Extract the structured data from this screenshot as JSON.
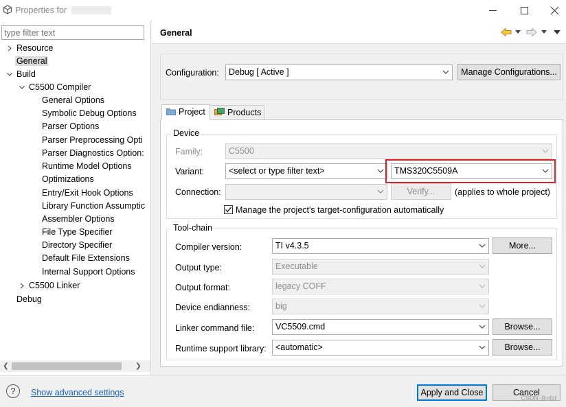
{
  "window": {
    "title": "Properties for"
  },
  "sidebar": {
    "filter_placeholder": "type filter text",
    "items": [
      {
        "label": "Resource"
      },
      {
        "label": "General"
      },
      {
        "label": "Build"
      },
      {
        "label": "C5500 Compiler"
      },
      {
        "label": "General Options"
      },
      {
        "label": "Symbolic Debug Options"
      },
      {
        "label": "Parser Options"
      },
      {
        "label": "Parser Preprocessing Opti"
      },
      {
        "label": "Parser Diagnostics Option:"
      },
      {
        "label": "Runtime Model Options"
      },
      {
        "label": "Optimizations"
      },
      {
        "label": "Entry/Exit Hook Options"
      },
      {
        "label": "Library Function Assumptic"
      },
      {
        "label": "Assembler Options"
      },
      {
        "label": "File Type Specifier"
      },
      {
        "label": "Directory Specifier"
      },
      {
        "label": "Default File Extensions"
      },
      {
        "label": "Internal Support Options"
      },
      {
        "label": "C5500 Linker"
      },
      {
        "label": "Debug"
      }
    ]
  },
  "page": {
    "title": "General",
    "configuration_label": "Configuration:",
    "configuration_value": "Debug  [ Active ]",
    "manage_button": "Manage Configurations...",
    "tabs": [
      {
        "label": "Project"
      },
      {
        "label": "Products"
      }
    ],
    "device": {
      "legend": "Device",
      "family_label": "Family:",
      "family_value": "C5500",
      "variant_label": "Variant:",
      "variant_filter": "<select or type filter text>",
      "variant_value": "TMS320C5509A",
      "connection_label": "Connection:",
      "connection_value": "",
      "verify_button": "Verify...",
      "applies_note": "(applies to whole project)",
      "manage_checkbox_label": "Manage the project's target-configuration automatically",
      "manage_checked": true
    },
    "toolchain": {
      "legend": "Tool-chain",
      "compiler_label": "Compiler version:",
      "compiler_value": "TI v4.3.5",
      "more_button": "More...",
      "output_type_label": "Output type:",
      "output_type_value": "Executable",
      "output_format_label": "Output format:",
      "output_format_value": "legacy COFF",
      "endianness_label": "Device endianness:",
      "endianness_value": "big",
      "linker_label": "Linker command file:",
      "linker_value": "VC5509.cmd",
      "browse_button": "Browse...",
      "runtime_label": "Runtime support library:",
      "runtime_value": "<automatic>",
      "browse_button_2": "Browse..."
    }
  },
  "footer": {
    "advanced_link": "Show advanced settings",
    "apply_close": "Apply and Close",
    "cancel": "Cancel",
    "watermark": "CSDN @nfsf"
  },
  "colors": {
    "highlight": "#d9232b",
    "link": "#1a5fb4",
    "primary_border": "#0078d7"
  }
}
